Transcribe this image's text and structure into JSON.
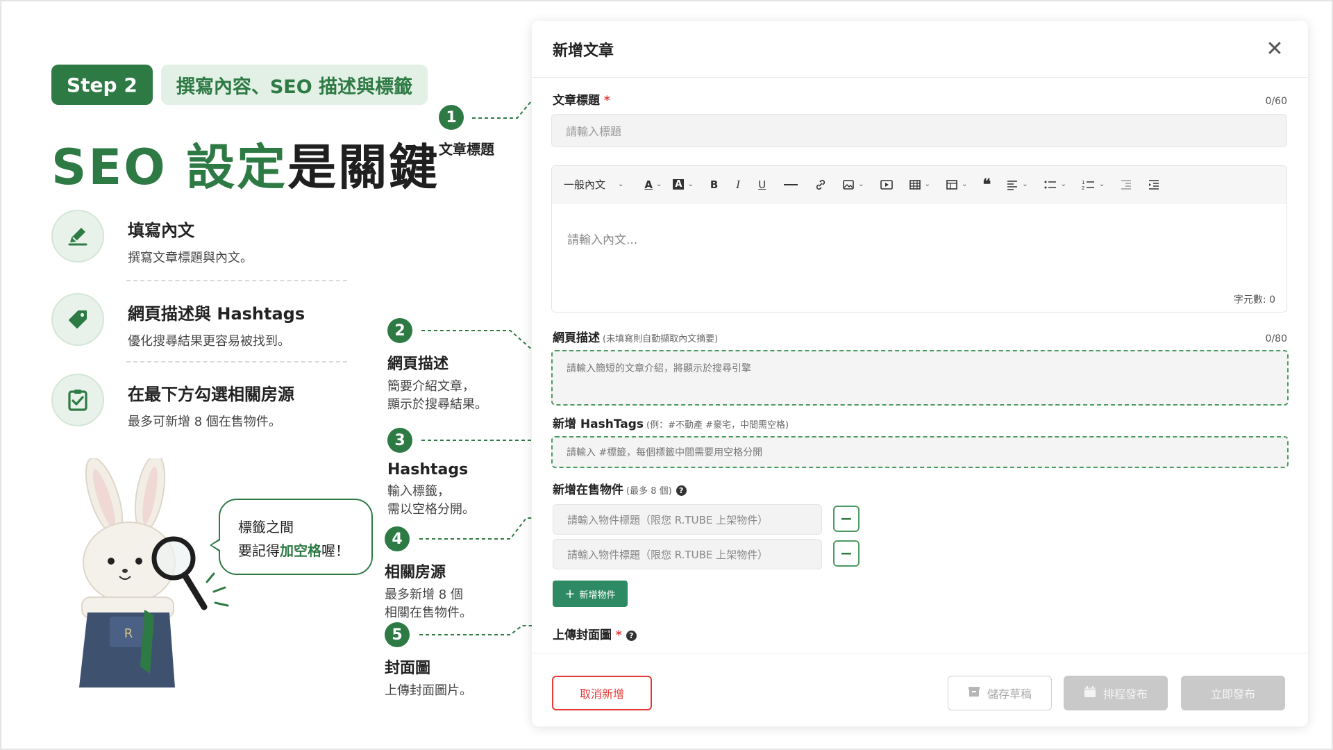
{
  "step": {
    "badge": "Step 2",
    "title": "撰寫內容、SEO 描述與標籤"
  },
  "headline": {
    "green": "SEO 設定",
    "dark": "是關鍵"
  },
  "features": [
    {
      "title": "填寫內文",
      "desc": "撰寫文章標題與內文。",
      "icon": "pencil-icon"
    },
    {
      "title": "網頁描述與 Hashtags",
      "desc": "優化搜尋結果更容易被找到。",
      "icon": "tag-icon"
    },
    {
      "title": "在最下方勾選相關房源",
      "desc": "最多可新增 8 個在售物件。",
      "icon": "checklist-icon"
    }
  ],
  "bubble": {
    "line1": "標籤之間",
    "line2_pre": "要記得",
    "line2_hl": "加空格",
    "line2_post": "喔！"
  },
  "callouts": [
    {
      "num": "1",
      "title": "文章標題",
      "desc1": "",
      "desc2": ""
    },
    {
      "num": "2",
      "title": "網頁描述",
      "desc1": "簡要介紹文章，",
      "desc2": "顯示於搜尋結果。"
    },
    {
      "num": "3",
      "title": "Hashtags",
      "desc1": "輸入標籤，",
      "desc2": "需以空格分開。"
    },
    {
      "num": "4",
      "title": "相關房源",
      "desc1": "最多新增 8 個",
      "desc2": "相關在售物件。"
    },
    {
      "num": "5",
      "title": "封面圖",
      "desc1": "上傳封面圖片。",
      "desc2": ""
    }
  ],
  "modal": {
    "title": "新增文章",
    "article_title": {
      "label": "文章標題",
      "required": "*",
      "counter": "0/60",
      "placeholder": "請輸入標題"
    },
    "editor": {
      "format": "一般內文",
      "placeholder": "請輸入內文...",
      "word_count": "字元數: 0"
    },
    "description": {
      "label": "網頁描述",
      "sub": "(未填寫則自動擷取內文摘要)",
      "counter": "0/80",
      "placeholder": "請輸入簡短的文章介紹，將顯示於搜尋引擎"
    },
    "hashtags": {
      "label": "新增 HashTags",
      "sub": "(例：#不動產 #豪宅，中間需空格)",
      "placeholder": "請輸入 #標籤，每個標籤中間需要用空格分開"
    },
    "listings": {
      "label": "新增在售物件",
      "sub": "(最多 8 個)",
      "placeholder": "請輸入物件標題（限您 R.TUBE 上架物件）",
      "add_label": "新增物件"
    },
    "cover": {
      "label": "上傳封面圖",
      "required": "*"
    },
    "footer": {
      "cancel": "取消新增",
      "draft": "儲存草稿",
      "schedule": "排程發布",
      "publish": "立即發布"
    }
  },
  "colors": {
    "brand_green": "#2e7a45",
    "light_green": "#e3f0e5",
    "danger": "#e53935",
    "disabled": "#c9c9c9"
  }
}
